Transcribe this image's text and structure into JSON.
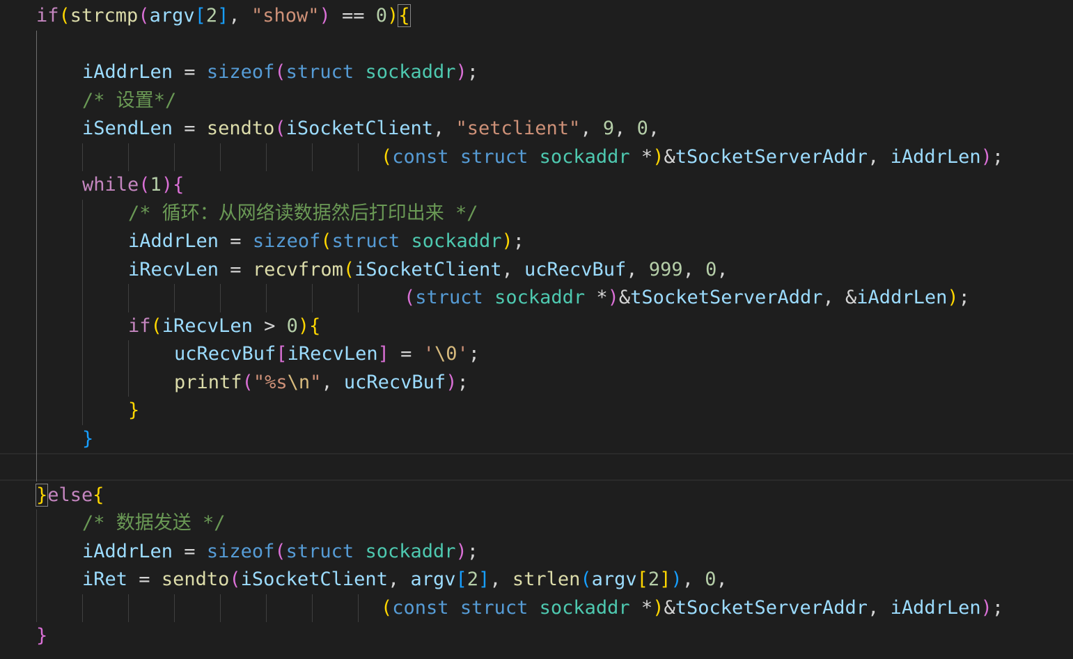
{
  "editor": {
    "language": "c",
    "theme": "dark",
    "colors": {
      "background": "#1e1e1e",
      "keyword_control": "#c586c0",
      "keyword": "#569cd6",
      "function": "#dcdcaa",
      "variable": "#9cdcfe",
      "string": "#ce9178",
      "number": "#b5cea8",
      "type": "#4ec9b0",
      "comment": "#6a9955",
      "bracket_level_1": "#ffd700",
      "bracket_level_2": "#da70d6",
      "bracket_level_3": "#179fff"
    },
    "lines": [
      {
        "indent": 0,
        "tokens": [
          [
            "kw",
            "if"
          ],
          [
            "b1",
            "("
          ],
          [
            "fn",
            "strcmp"
          ],
          [
            "b2",
            "("
          ],
          [
            "var",
            "argv"
          ],
          [
            "b3",
            "["
          ],
          [
            "num",
            "2"
          ],
          [
            "b3",
            "]"
          ],
          [
            "p",
            ", "
          ],
          [
            "str",
            "\"show\""
          ],
          [
            "b2",
            ")"
          ],
          [
            "p",
            " == "
          ],
          [
            "num",
            "0"
          ],
          [
            "b1",
            ")"
          ],
          [
            "b1m",
            "{"
          ]
        ]
      },
      {
        "indent": 0,
        "tokens": []
      },
      {
        "indent": 4,
        "tokens": [
          [
            "var",
            "iAddrLen"
          ],
          [
            "p",
            " = "
          ],
          [
            "kwb",
            "sizeof"
          ],
          [
            "b2",
            "("
          ],
          [
            "kwb",
            "struct"
          ],
          [
            "p",
            " "
          ],
          [
            "type",
            "sockaddr"
          ],
          [
            "b2",
            ")"
          ],
          [
            "p",
            ";"
          ]
        ]
      },
      {
        "indent": 4,
        "tokens": [
          [
            "com",
            "/* 设置*/"
          ]
        ]
      },
      {
        "indent": 4,
        "tokens": [
          [
            "var",
            "iSendLen"
          ],
          [
            "p",
            " = "
          ],
          [
            "fn",
            "sendto"
          ],
          [
            "b2",
            "("
          ],
          [
            "var",
            "iSocketClient"
          ],
          [
            "p",
            ", "
          ],
          [
            "str",
            "\"setclient\""
          ],
          [
            "p",
            ", "
          ],
          [
            "num",
            "9"
          ],
          [
            "p",
            ", "
          ],
          [
            "num",
            "0"
          ],
          [
            "p",
            ","
          ]
        ]
      },
      {
        "indent": 30,
        "tokens": [
          [
            "b1",
            "("
          ],
          [
            "kwb",
            "const"
          ],
          [
            "p",
            " "
          ],
          [
            "kwb",
            "struct"
          ],
          [
            "p",
            " "
          ],
          [
            "type",
            "sockaddr"
          ],
          [
            "p",
            " *"
          ],
          [
            "b1",
            ")"
          ],
          [
            "p",
            "&"
          ],
          [
            "var",
            "tSocketServerAddr"
          ],
          [
            "p",
            ", "
          ],
          [
            "var",
            "iAddrLen"
          ],
          [
            "b2",
            ")"
          ],
          [
            "p",
            ";"
          ]
        ]
      },
      {
        "indent": 4,
        "tokens": [
          [
            "kw",
            "while"
          ],
          [
            "b2",
            "("
          ],
          [
            "num",
            "1"
          ],
          [
            "b2",
            ")"
          ],
          [
            "b2",
            "{"
          ]
        ]
      },
      {
        "indent": 8,
        "tokens": [
          [
            "com",
            "/* 循环：从网络读数据然后打印出来 */"
          ]
        ]
      },
      {
        "indent": 8,
        "tokens": [
          [
            "var",
            "iAddrLen"
          ],
          [
            "p",
            " = "
          ],
          [
            "kwb",
            "sizeof"
          ],
          [
            "b1",
            "("
          ],
          [
            "kwb",
            "struct"
          ],
          [
            "p",
            " "
          ],
          [
            "type",
            "sockaddr"
          ],
          [
            "b1",
            ")"
          ],
          [
            "p",
            ";"
          ]
        ]
      },
      {
        "indent": 8,
        "tokens": [
          [
            "var",
            "iRecvLen"
          ],
          [
            "p",
            " = "
          ],
          [
            "fn",
            "recvfrom"
          ],
          [
            "b1",
            "("
          ],
          [
            "var",
            "iSocketClient"
          ],
          [
            "p",
            ", "
          ],
          [
            "var",
            "ucRecvBuf"
          ],
          [
            "p",
            ", "
          ],
          [
            "num",
            "999"
          ],
          [
            "p",
            ", "
          ],
          [
            "num",
            "0"
          ],
          [
            "p",
            ","
          ]
        ]
      },
      {
        "indent": 32,
        "tokens": [
          [
            "b2",
            "("
          ],
          [
            "kwb",
            "struct"
          ],
          [
            "p",
            " "
          ],
          [
            "type",
            "sockaddr"
          ],
          [
            "p",
            " *"
          ],
          [
            "b2",
            ")"
          ],
          [
            "p",
            "&"
          ],
          [
            "var",
            "tSocketServerAddr"
          ],
          [
            "p",
            ", &"
          ],
          [
            "var",
            "iAddrLen"
          ],
          [
            "b1",
            ")"
          ],
          [
            "p",
            ";"
          ]
        ]
      },
      {
        "indent": 8,
        "tokens": [
          [
            "kw",
            "if"
          ],
          [
            "b1",
            "("
          ],
          [
            "var",
            "iRecvLen"
          ],
          [
            "p",
            " > "
          ],
          [
            "num",
            "0"
          ],
          [
            "b1",
            ")"
          ],
          [
            "b1",
            "{"
          ]
        ]
      },
      {
        "indent": 12,
        "tokens": [
          [
            "var",
            "ucRecvBuf"
          ],
          [
            "b2",
            "["
          ],
          [
            "var",
            "iRecvLen"
          ],
          [
            "b2",
            "]"
          ],
          [
            "p",
            " = "
          ],
          [
            "str",
            "'"
          ],
          [
            "esc",
            "\\0"
          ],
          [
            "str",
            "'"
          ],
          [
            "p",
            ";"
          ]
        ]
      },
      {
        "indent": 12,
        "tokens": [
          [
            "fn",
            "printf"
          ],
          [
            "b2",
            "("
          ],
          [
            "str",
            "\"%s"
          ],
          [
            "esc",
            "\\n"
          ],
          [
            "str",
            "\""
          ],
          [
            "p",
            ", "
          ],
          [
            "var",
            "ucRecvBuf"
          ],
          [
            "b2",
            ")"
          ],
          [
            "p",
            ";"
          ]
        ]
      },
      {
        "indent": 8,
        "tokens": [
          [
            "b1",
            "}"
          ]
        ]
      },
      {
        "indent": 4,
        "tokens": [
          [
            "b3",
            "}"
          ]
        ]
      },
      {
        "indent": 0,
        "tokens": []
      },
      {
        "indent": 0,
        "tokens": [
          [
            "b1m",
            "}"
          ],
          [
            "kw",
            "else"
          ],
          [
            "b1",
            "{"
          ]
        ]
      },
      {
        "indent": 4,
        "tokens": [
          [
            "com",
            "/* 数据发送 */"
          ]
        ]
      },
      {
        "indent": 4,
        "tokens": [
          [
            "var",
            "iAddrLen"
          ],
          [
            "p",
            " = "
          ],
          [
            "kwb",
            "sizeof"
          ],
          [
            "b2",
            "("
          ],
          [
            "kwb",
            "struct"
          ],
          [
            "p",
            " "
          ],
          [
            "type",
            "sockaddr"
          ],
          [
            "b2",
            ")"
          ],
          [
            "p",
            ";"
          ]
        ]
      },
      {
        "indent": 4,
        "tokens": [
          [
            "var",
            "iRet"
          ],
          [
            "p",
            " = "
          ],
          [
            "fn",
            "sendto"
          ],
          [
            "b2",
            "("
          ],
          [
            "var",
            "iSocketClient"
          ],
          [
            "p",
            ", "
          ],
          [
            "var",
            "argv"
          ],
          [
            "b3",
            "["
          ],
          [
            "num",
            "2"
          ],
          [
            "b3",
            "]"
          ],
          [
            "p",
            ", "
          ],
          [
            "fn",
            "strlen"
          ],
          [
            "b3",
            "("
          ],
          [
            "var",
            "argv"
          ],
          [
            "b1",
            "["
          ],
          [
            "num",
            "2"
          ],
          [
            "b1",
            "]"
          ],
          [
            "b3",
            ")"
          ],
          [
            "p",
            ", "
          ],
          [
            "num",
            "0"
          ],
          [
            "p",
            ","
          ]
        ]
      },
      {
        "indent": 30,
        "tokens": [
          [
            "b1",
            "("
          ],
          [
            "kwb",
            "const"
          ],
          [
            "p",
            " "
          ],
          [
            "kwb",
            "struct"
          ],
          [
            "p",
            " "
          ],
          [
            "type",
            "sockaddr"
          ],
          [
            "p",
            " *"
          ],
          [
            "b1",
            ")"
          ],
          [
            "p",
            "&"
          ],
          [
            "var",
            "tSocketServerAddr"
          ],
          [
            "p",
            ", "
          ],
          [
            "var",
            "iAddrLen"
          ],
          [
            "b2",
            ")"
          ],
          [
            "p",
            ";"
          ]
        ]
      },
      {
        "indent": 0,
        "tokens": [
          [
            "b2",
            "}"
          ]
        ]
      }
    ]
  }
}
